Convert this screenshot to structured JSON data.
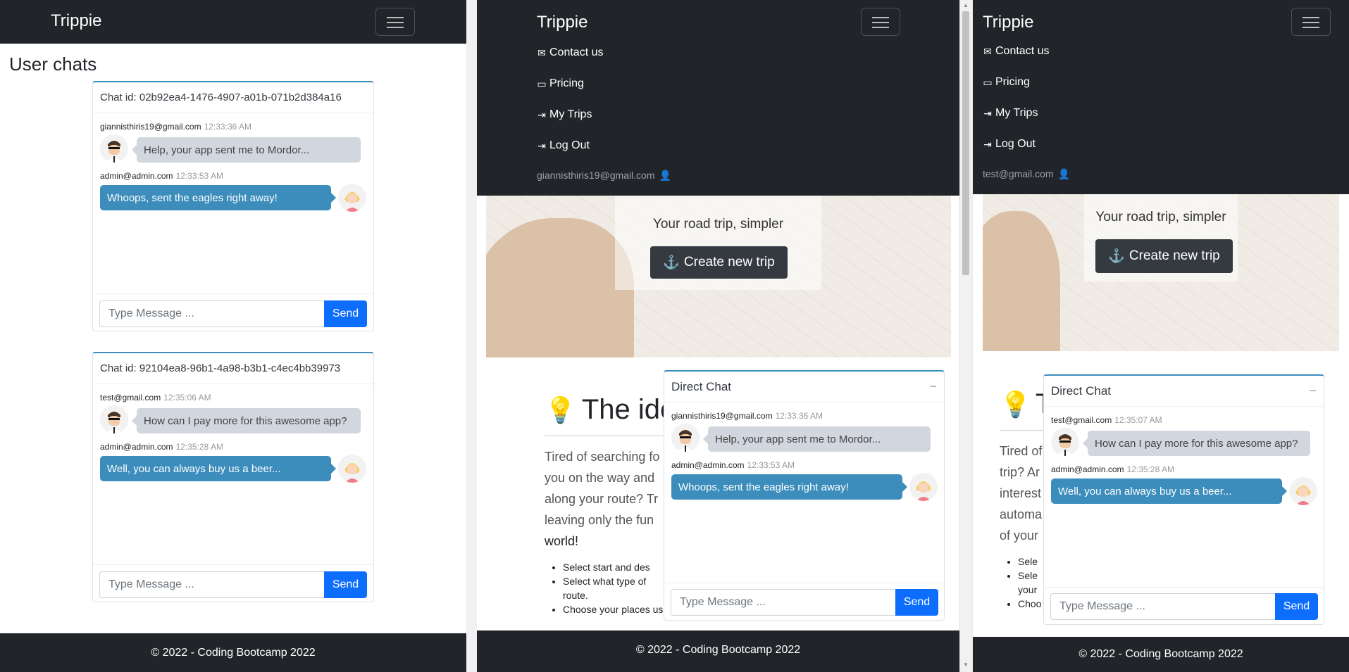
{
  "brand": "Trippie",
  "footer": "© 2022 - Coding Bootcamp 2022",
  "window1": {
    "page_title": "User chats",
    "chats": [
      {
        "title": "Chat id: 02b92ea4-1476-4907-a01b-071b2d384a16",
        "in_user": "giannisthiris19@gmail.com",
        "in_time": "12:33:36 AM",
        "in_text": "Help, your app sent me to Mordor...",
        "out_user": "admin@admin.com",
        "out_time": "12:33:53 AM",
        "out_text": "Whoops, sent the eagles right away!",
        "placeholder": "Type Message ...",
        "send": "Send"
      },
      {
        "title": "Chat id: 92104ea8-96b1-4a98-b3b1-c4ec4bb39973",
        "in_user": "test@gmail.com",
        "in_time": "12:35:06 AM",
        "in_text": "How can I pay more for this awesome app?",
        "out_user": "admin@admin.com",
        "out_time": "12:35:28 AM",
        "out_text": "Well, you can always buy us a beer...",
        "placeholder": "Type Message ...",
        "send": "Send"
      }
    ]
  },
  "nav": {
    "contact": "Contact us",
    "pricing": "Pricing",
    "trips": "My Trips",
    "logout": "Log Out"
  },
  "hero": {
    "subtitle": "Your road trip, simpler",
    "button": "Create new trip"
  },
  "window2": {
    "user": "giannisthiris19@gmail.com",
    "idea_title": "The ide",
    "idea_lines": [
      "Tired of searching fo",
      "you on the way and",
      "along your route? Tr",
      "leaving only the fun",
      "world!"
    ],
    "bullets": [
      "Select start and des",
      "Select what type of",
      "route.",
      "Choose your places using an intuitive user interface"
    ],
    "chat": {
      "title": "Direct Chat",
      "minimize": "−",
      "in_user": "giannisthiris19@gmail.com",
      "in_time": "12:33:36 AM",
      "in_text": "Help, your app sent me to Mordor...",
      "out_user": "admin@admin.com",
      "out_time": "12:33:53 AM",
      "out_text": "Whoops, sent the eagles right away!",
      "placeholder": "Type Message ...",
      "send": "Send"
    }
  },
  "window3": {
    "user": "test@gmail.com",
    "idea_title": "T",
    "idea_lines": [
      "Tired of",
      "trip? Ar",
      "interest",
      "automa",
      "of your"
    ],
    "bullets": [
      "Sele",
      "Sele",
      "your",
      "Choo"
    ],
    "chat": {
      "title": "Direct Chat",
      "minimize": "−",
      "in_user": "test@gmail.com",
      "in_time": "12:35:07 AM",
      "in_text": "How can I pay more for this awesome app?",
      "out_user": "admin@admin.com",
      "out_time": "12:35:28 AM",
      "out_text": "Well, you can always buy us a beer...",
      "placeholder": "Type Message ...",
      "send": "Send"
    }
  }
}
